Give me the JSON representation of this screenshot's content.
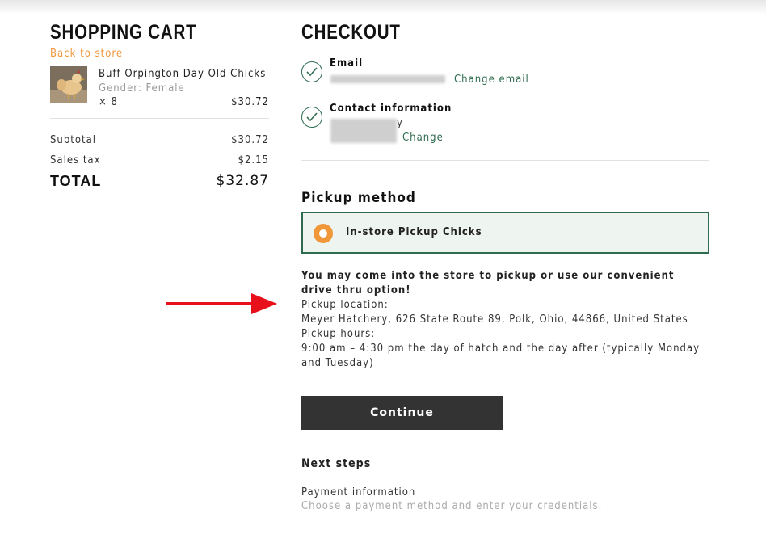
{
  "cart": {
    "title": "SHOPPING CART",
    "back_link": "Back to store",
    "item": {
      "name": "Buff Orpington Day Old Chicks",
      "meta": "Gender: Female",
      "qty": "× 8",
      "price": "$30.72"
    },
    "subtotal_label": "Subtotal",
    "subtotal_value": "$30.72",
    "tax_label": "Sales tax",
    "tax_value": "$2.15",
    "total_label": "TOTAL",
    "total_value": "$32.87"
  },
  "checkout": {
    "title": "CHECKOUT",
    "email_title": "Email",
    "email_change": "Change email",
    "contact_title": "Contact information",
    "contact_partial": "y",
    "contact_change": "Change",
    "pickup_method_title": "Pickup method",
    "pickup_option": "In-store Pickup Chicks",
    "pickup_lead": "You may come into the store to pickup or use our convenient drive thru option!",
    "pickup_location_label": "Pickup location:",
    "pickup_location": "Meyer Hatchery, 626 State Route 89, Polk, Ohio, 44866, United States",
    "pickup_hours_label": "Pickup hours:",
    "pickup_hours": "9:00 am – 4:30 pm the day of hatch and the day after (typically Monday and Tuesday)",
    "continue_label": "Continue",
    "next_steps_title": "Next steps",
    "next_step_name": "Payment information",
    "next_step_desc": "Choose a payment method and enter your credentials."
  },
  "colors": {
    "accent_orange": "#f0973a",
    "green": "#2e6b4f",
    "button_dark": "#333333",
    "arrow_red": "#e8101a"
  },
  "icons": [
    "check-circle-icon",
    "radio-selected-icon",
    "red-arrow-annotation"
  ]
}
